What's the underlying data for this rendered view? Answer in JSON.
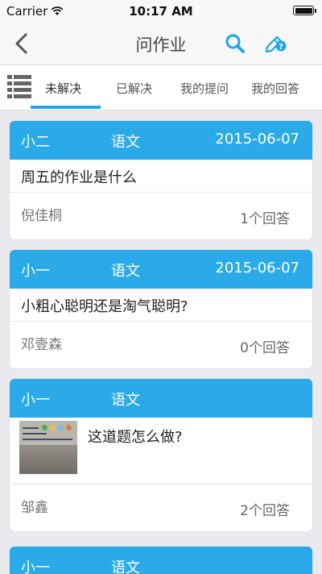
{
  "status_bar": {
    "carrier": "Carrier",
    "time": "10:17 AM"
  },
  "nav": {
    "title": "问作业",
    "back_icon": "chevron-left-icon",
    "search_icon": "search-icon",
    "ask_icon": "pencil-question-icon",
    "accent_color": "#1ea6e6"
  },
  "tabs": {
    "items": [
      {
        "label": "未解决",
        "active": true
      },
      {
        "label": "已解决",
        "active": false
      },
      {
        "label": "我的提问",
        "active": false
      },
      {
        "label": "我的回答",
        "active": false
      }
    ]
  },
  "cards": [
    {
      "student": "小二",
      "subject": "语文",
      "date": "2015-06-07",
      "question": "周五的作业是什么",
      "asker": "倪佳桐",
      "answers": "1个回答"
    },
    {
      "student": "小一",
      "subject": "语文",
      "date": "2015-06-07",
      "question": "小粗心聪明还是淘气聪明?",
      "asker": "邓壹森",
      "answers": "0个回答"
    },
    {
      "student": "小一",
      "subject": "语文",
      "date": "",
      "question": "这道题怎么做?",
      "asker": "邹鑫",
      "answers": "2个回答"
    },
    {
      "student": "小一",
      "subject": "语文"
    }
  ],
  "colors": {
    "card_header": "#2aaae9",
    "background": "#e9e9ee"
  }
}
